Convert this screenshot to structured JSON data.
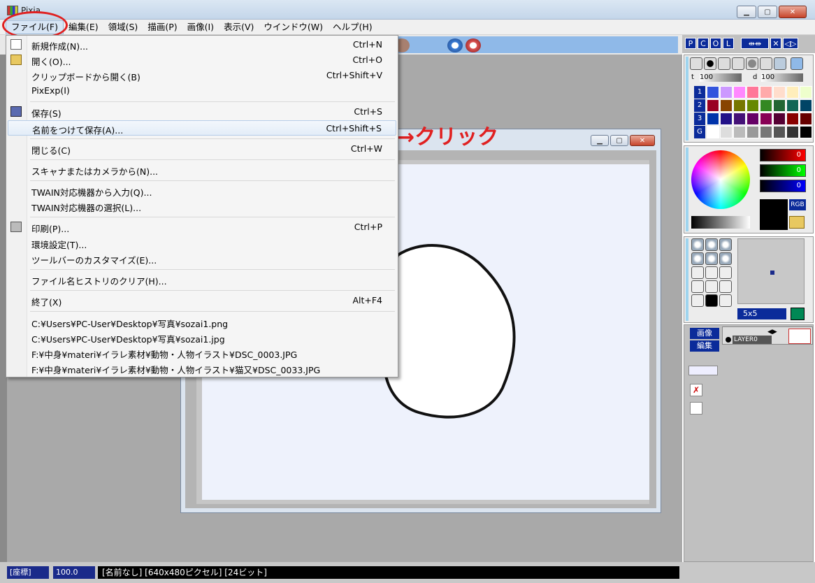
{
  "window": {
    "title": "Pixia",
    "minimize": "▁",
    "maximize": "▢",
    "close": "✕"
  },
  "menubar": {
    "items": [
      {
        "label": "ファイル(F)"
      },
      {
        "label": "編集(E)"
      },
      {
        "label": "領域(S)"
      },
      {
        "label": "描画(P)"
      },
      {
        "label": "画像(I)"
      },
      {
        "label": "表示(V)"
      },
      {
        "label": "ウインドウ(W)"
      },
      {
        "label": "ヘルプ(H)"
      }
    ]
  },
  "file_menu": {
    "new": {
      "label": "新規作成(N)...",
      "shortcut": "Ctrl+N"
    },
    "open": {
      "label": "開く(O)...",
      "shortcut": "Ctrl+O"
    },
    "open_clipboard": {
      "label": "クリップボードから開く(B)",
      "shortcut": "Ctrl+Shift+V"
    },
    "pixexp": {
      "label": "PixExp(I)"
    },
    "save": {
      "label": "保存(S)",
      "shortcut": "Ctrl+S"
    },
    "save_as": {
      "label": "名前をつけて保存(A)...",
      "shortcut": "Ctrl+Shift+S"
    },
    "close": {
      "label": "閉じる(C)",
      "shortcut": "Ctrl+W"
    },
    "scanner": {
      "label": "スキャナまたはカメラから(N)..."
    },
    "twain_input": {
      "label": "TWAIN対応機器から入力(Q)..."
    },
    "twain_select": {
      "label": "TWAIN対応機器の選択(L)..."
    },
    "print": {
      "label": "印刷(P)...",
      "shortcut": "Ctrl+P"
    },
    "preferences": {
      "label": "環境設定(T)..."
    },
    "toolbar_customize": {
      "label": "ツールバーのカスタマイズ(E)..."
    },
    "clear_history": {
      "label": "ファイル名ヒストリのクリア(H)..."
    },
    "exit": {
      "label": "終了(X)",
      "shortcut": "Alt+F4"
    },
    "recent": [
      "C:¥Users¥PC-User¥Desktop¥写真¥sozai1.png",
      "C:¥Users¥PC-User¥Desktop¥写真¥sozai1.jpg",
      "F:¥中身¥materi¥イラレ素材¥動物・人物イラスト¥DSC_0003.JPG",
      "F:¥中身¥materi¥イラレ素材¥動物・人物イラスト¥猫又¥DSC_0033.JPG"
    ]
  },
  "annotation": {
    "text": "→クリック",
    "color": "#e02020"
  },
  "statusbar": {
    "coord_label": "[座標]",
    "zoom": "100.0",
    "info": "[名前なし] [640x480ピクセル] [24ビット]"
  },
  "right_panel": {
    "tabs": [
      "P",
      "C",
      "O",
      "L"
    ],
    "opacity_t": "t",
    "opacity_t_value": "100",
    "opacity_d": "d",
    "opacity_d_value": "100",
    "palette_rows": [
      "1",
      "2",
      "3",
      "G"
    ],
    "rgb_values": {
      "r": "0",
      "g": "0",
      "b": "0"
    },
    "rgb_label": "RGB",
    "brush_size": "5x5",
    "nav_image": "画像",
    "nav_edit": "編集",
    "layer_name": "LAYER0"
  },
  "colors": {
    "accent_blue": "#0b2b9a",
    "menu_hover": "#e3edf8",
    "annotation_red": "#e02020"
  }
}
